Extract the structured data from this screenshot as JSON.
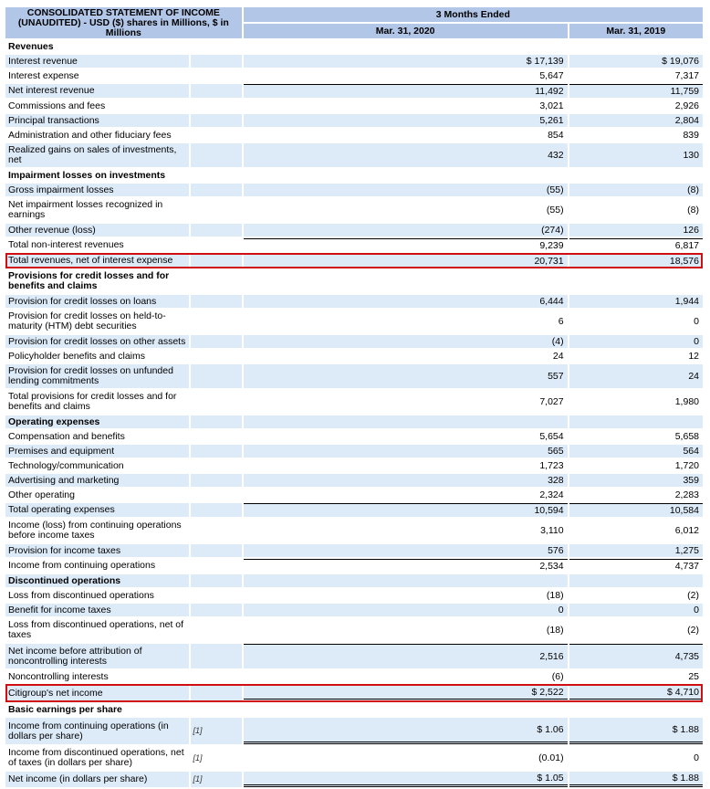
{
  "header": {
    "title": "CONSOLIDATED STATEMENT OF INCOME (UNAUDITED) - USD ($) shares in Millions, $ in Millions",
    "period_group": "3 Months Ended",
    "col1": "Mar. 31, 2020",
    "col2": "Mar. 31, 2019"
  },
  "rows": [
    {
      "label": "Revenues",
      "note": "",
      "v1": "",
      "v2": "",
      "header": true
    },
    {
      "label": "Interest revenue",
      "note": "",
      "v1": "$ 17,139",
      "v2": "$ 19,076"
    },
    {
      "label": "Interest expense",
      "note": "",
      "v1": "5,647",
      "v2": "7,317"
    },
    {
      "label": "Net interest revenue",
      "note": "",
      "v1": "11,492",
      "v2": "11,759"
    },
    {
      "label": "Commissions and fees",
      "note": "",
      "v1": "3,021",
      "v2": "2,926"
    },
    {
      "label": "Principal transactions",
      "note": "",
      "v1": "5,261",
      "v2": "2,804"
    },
    {
      "label": "Administration and other fiduciary fees",
      "note": "",
      "v1": "854",
      "v2": "839"
    },
    {
      "label": "Realized gains on sales of investments, net",
      "note": "",
      "v1": "432",
      "v2": "130",
      "tall": true
    },
    {
      "label": "Impairment losses on investments",
      "note": "",
      "v1": "",
      "v2": "",
      "header": true
    },
    {
      "label": "Gross impairment losses",
      "note": "",
      "v1": "(55)",
      "v2": "(8)"
    },
    {
      "label": "Net impairment losses recognized in earnings",
      "note": "",
      "v1": "(55)",
      "v2": "(8)",
      "tall": true
    },
    {
      "label": "Other revenue (loss)",
      "note": "",
      "v1": "(274)",
      "v2": "126"
    },
    {
      "label": "Total non-interest revenues",
      "note": "",
      "v1": "9,239",
      "v2": "6,817"
    },
    {
      "label": "Total revenues, net of interest expense",
      "note": "",
      "v1": "20,731",
      "v2": "18,576",
      "highlight": true
    },
    {
      "label": "Provisions for credit losses and for benefits and claims",
      "note": "",
      "v1": "",
      "v2": "",
      "header": true,
      "tall": true
    },
    {
      "label": "Provision for credit losses on loans",
      "note": "",
      "v1": "6,444",
      "v2": "1,944"
    },
    {
      "label": "Provision for credit losses on held-to-maturity (HTM) debt securities",
      "note": "",
      "v1": "6",
      "v2": "0",
      "tall": true
    },
    {
      "label": "Provision for credit losses on other assets",
      "note": "",
      "v1": "(4)",
      "v2": "0"
    },
    {
      "label": "Policyholder benefits and claims",
      "note": "",
      "v1": "24",
      "v2": "12"
    },
    {
      "label": "Provision for credit losses on unfunded lending commitments",
      "note": "",
      "v1": "557",
      "v2": "24",
      "tall": true
    },
    {
      "label": "Total provisions for credit losses and for benefits and claims",
      "note": "",
      "v1": "7,027",
      "v2": "1,980",
      "tall": true
    },
    {
      "label": "Operating expenses",
      "note": "",
      "v1": "",
      "v2": "",
      "header": true
    },
    {
      "label": "Compensation and benefits",
      "note": "",
      "v1": "5,654",
      "v2": "5,658"
    },
    {
      "label": "Premises and equipment",
      "note": "",
      "v1": "565",
      "v2": "564"
    },
    {
      "label": "Technology/communication",
      "note": "",
      "v1": "1,723",
      "v2": "1,720"
    },
    {
      "label": "Advertising and marketing",
      "note": "",
      "v1": "328",
      "v2": "359"
    },
    {
      "label": "Other operating",
      "note": "",
      "v1": "2,324",
      "v2": "2,283"
    },
    {
      "label": "Total operating expenses",
      "note": "",
      "v1": "10,594",
      "v2": "10,584"
    },
    {
      "label": "Income (loss) from continuing operations before income taxes",
      "note": "",
      "v1": "3,110",
      "v2": "6,012",
      "tall": true
    },
    {
      "label": "Provision for income taxes",
      "note": "",
      "v1": "576",
      "v2": "1,275"
    },
    {
      "label": "Income from continuing operations",
      "note": "",
      "v1": "2,534",
      "v2": "4,737"
    },
    {
      "label": "Discontinued operations",
      "note": "",
      "v1": "",
      "v2": "",
      "header": true
    },
    {
      "label": "Loss from discontinued operations",
      "note": "",
      "v1": "(18)",
      "v2": "(2)"
    },
    {
      "label": "Benefit for income taxes",
      "note": "",
      "v1": "0",
      "v2": "0"
    },
    {
      "label": "Loss from discontinued operations, net of taxes",
      "note": "",
      "v1": "(18)",
      "v2": "(2)",
      "tall": true
    },
    {
      "label": "Net income before attribution of noncontrolling interests",
      "note": "",
      "v1": "2,516",
      "v2": "4,735",
      "tall": true
    },
    {
      "label": "Noncontrolling interests",
      "note": "",
      "v1": "(6)",
      "v2": "25"
    },
    {
      "label": "Citigroup's net income",
      "note": "",
      "v1": "$ 2,522",
      "v2": "$ 4,710",
      "highlight": true
    },
    {
      "label": "Basic earnings per share",
      "note": "",
      "v1": "",
      "v2": "",
      "header": true
    },
    {
      "label": "Income from continuing operations (in dollars per share)",
      "note": "[1]",
      "v1": "$ 1.06",
      "v2": "$ 1.88",
      "tall": true
    },
    {
      "label": "Income from discontinued operations, net of taxes (in dollars per share)",
      "note": "[1]",
      "v1": "(0.01)",
      "v2": "0",
      "tall": true
    },
    {
      "label": "Net income (in dollars per share)",
      "note": "[1]",
      "v1": "$ 1.05",
      "v2": "$ 1.88"
    }
  ],
  "highlight_color": "#d01010",
  "stripe_color": "#ddeaf8",
  "header_color": "#b2c6e8"
}
